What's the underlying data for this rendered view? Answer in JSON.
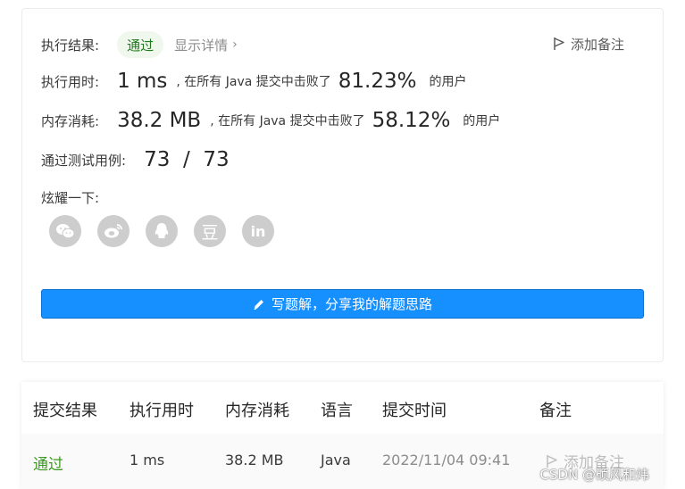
{
  "result": {
    "label": "执行结果:",
    "status": "通过",
    "details_link": "显示详情",
    "add_note": "添加备注"
  },
  "runtime": {
    "label": "执行用时:",
    "value": "1 ms",
    "beat_text": ", 在所有 Java 提交中击败了",
    "percent": "81.23%",
    "tail": "的用户"
  },
  "memory": {
    "label": "内存消耗:",
    "value": "38.2 MB",
    "beat_text": ", 在所有 Java 提交中击败了",
    "percent": "58.12%",
    "tail": "的用户"
  },
  "tests": {
    "label": "通过测试用例:",
    "value": "73  /  73"
  },
  "share": {
    "label": "炫耀一下:",
    "icons": [
      "wechat-icon",
      "weibo-icon",
      "qq-icon",
      "douban-icon",
      "linkedin-icon"
    ],
    "douban_glyph": "豆",
    "linkedin_glyph": "in"
  },
  "solution_button": "写题解，分享我的解题思路",
  "table": {
    "headers": [
      "提交结果",
      "执行用时",
      "内存消耗",
      "语言",
      "提交时间",
      "备注"
    ],
    "row": {
      "status": "通过",
      "runtime": "1 ms",
      "memory": "38.2 MB",
      "language": "Java",
      "time": "2022/11/04 09:41",
      "note": "添加备注"
    }
  },
  "watermark": "CSDN @硕风和炜",
  "colors": {
    "accent": "#1690ff",
    "success": "#3c9a23",
    "badge_bg": "#f0f7ec",
    "icon_gray": "#cdcdcd"
  }
}
